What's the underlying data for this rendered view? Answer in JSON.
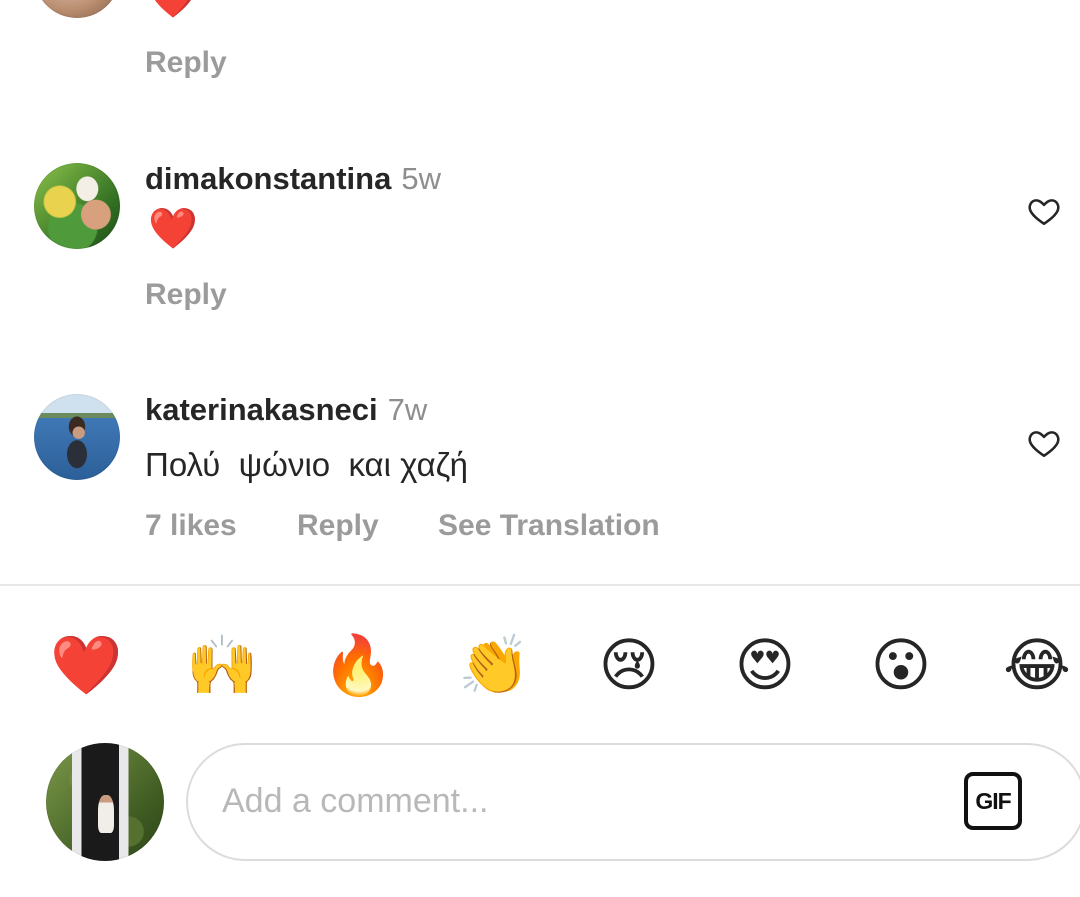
{
  "comments": [
    {
      "username": "",
      "time": "",
      "text": "❤️",
      "actions": {
        "reply": "Reply"
      }
    },
    {
      "username": "dimakonstantina",
      "time": "5w",
      "text": "❤️",
      "actions": {
        "reply": "Reply"
      }
    },
    {
      "username": "katerinakasneci",
      "time": "7w",
      "text": "Πολύ  ψώνιο  και χαζή",
      "actions": {
        "likes": "7 likes",
        "reply": "Reply",
        "translate": "See Translation"
      }
    }
  ],
  "icons": {
    "like": "heart-outline-icon"
  },
  "quick_reactions": [
    "❤️",
    "🙌",
    "🔥",
    "👏",
    "😢",
    "😍",
    "😮",
    "😂"
  ],
  "composer": {
    "placeholder": "Add a comment...",
    "gif_label": "GIF"
  },
  "colors": {
    "heart_red": "#ed2c3b",
    "muted": "#8e8e8e",
    "text": "#262626"
  }
}
